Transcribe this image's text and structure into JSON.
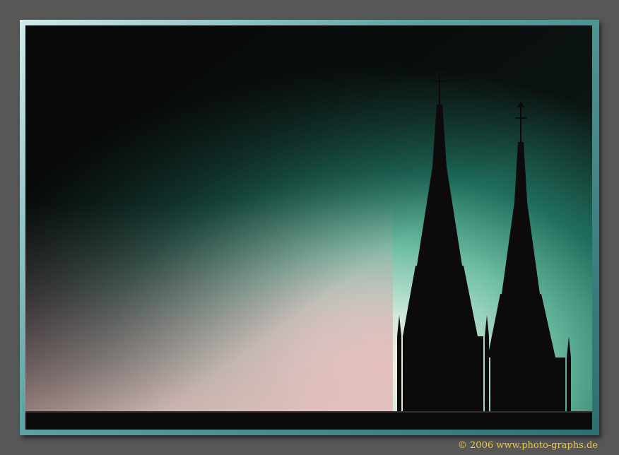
{
  "photo": {
    "subject": "church-spires-silhouette",
    "colors": {
      "sky_top": "#0e1a18",
      "sky_mid": "#1f6f5d",
      "sky_light": "#9ad8c2",
      "sky_horizon": "#d9a8b0",
      "silhouette": "#0d0a0c",
      "frame": "#5fa3a4",
      "background": "#575757"
    }
  },
  "footer": {
    "copyright": "© 2006 www.photo-graphs.de"
  }
}
